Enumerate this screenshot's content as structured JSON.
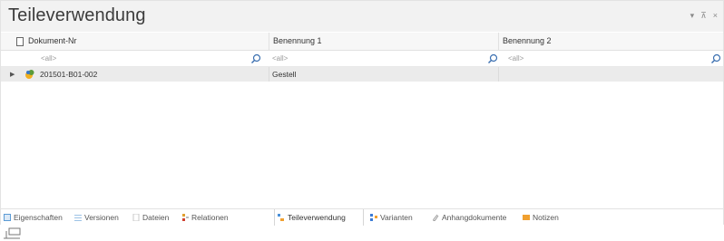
{
  "panel": {
    "title": "Teileverwendung",
    "controls": {
      "dropdown": "▾",
      "pin": "⊼",
      "close": "×"
    }
  },
  "grid": {
    "columns": [
      "Dokument-Nr",
      "Benennung 1",
      "Benennung 2"
    ],
    "filters": [
      "<all>",
      "<all>",
      "<all>"
    ],
    "rows": [
      {
        "doc_nr": "201501-B01-002",
        "benennung1": "Gestell",
        "benennung2": ""
      }
    ]
  },
  "tabs": [
    {
      "label": "Eigenschaften",
      "icon": "properties-icon",
      "color": "#5b9bd5"
    },
    {
      "label": "Versionen",
      "icon": "versions-icon",
      "color": "#9dc3e6"
    },
    {
      "label": "Dateien",
      "icon": "files-icon",
      "color": "#d0d0d0"
    },
    {
      "label": "Relationen",
      "icon": "relations-icon",
      "color": "#e0a030"
    },
    {
      "label": "Teileverwendung",
      "icon": "where-used-icon",
      "color": "#4a90d9",
      "active": true
    },
    {
      "label": "Varianten",
      "icon": "variants-icon",
      "color": "#3a7bd5"
    },
    {
      "label": "Anhangdokumente",
      "icon": "attachment-icon",
      "color": "#999999"
    },
    {
      "label": "Notizen",
      "icon": "notes-icon",
      "color": "#f0a030"
    }
  ],
  "colors": {
    "accent": "#4a90d9",
    "row_bg": "#ebebeb",
    "part_icon": "#f2b020"
  }
}
